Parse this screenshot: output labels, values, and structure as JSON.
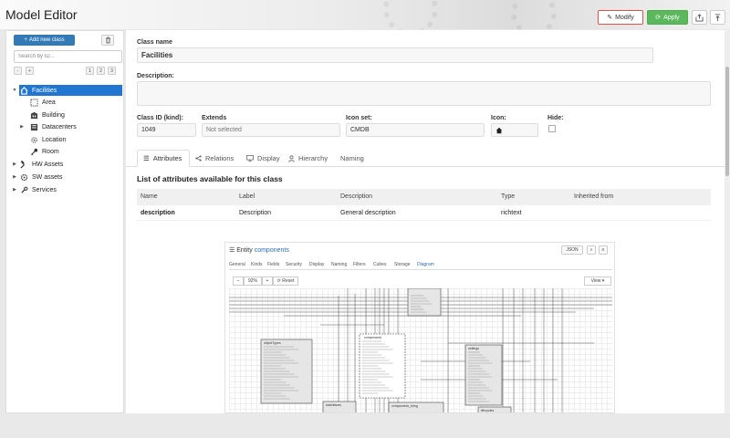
{
  "app": {
    "title": "Model Editor"
  },
  "toolbar": {
    "modify_label": "Modify",
    "apply_label": "Apply"
  },
  "sidebar": {
    "add_label": "Add new class",
    "search_placeholder": "Search by ID...",
    "collapse_label": "-",
    "expand_label": "+",
    "levels": [
      "1",
      "2",
      "3"
    ],
    "tree": [
      {
        "label": "Facilities",
        "icon": "home-icon",
        "selected": true
      },
      {
        "label": "Area",
        "icon": "dashed-square-icon"
      },
      {
        "label": "Building",
        "icon": "building-icon"
      },
      {
        "label": "Datacenters",
        "icon": "datacenter-icon"
      },
      {
        "label": "Location",
        "icon": "crosshair-icon"
      },
      {
        "label": "Room",
        "icon": "key-icon"
      },
      {
        "label": "HW Assets",
        "icon": "hammer-icon"
      },
      {
        "label": "SW assets",
        "icon": "gears-icon"
      },
      {
        "label": "Services",
        "icon": "wrench-icon"
      }
    ]
  },
  "form": {
    "class_name_label": "Class name",
    "class_name_value": "Facilities",
    "description_label": "Description:",
    "description_value": "",
    "class_id_label": "Class ID (kind):",
    "class_id_value": "1049",
    "extends_label": "Extends",
    "extends_value": "Not selected",
    "iconset_label": "Icon set:",
    "iconset_value": "CMDB",
    "icon_label": "Icon:",
    "hide_label": "Hide:"
  },
  "tabs": [
    {
      "label": "Attributes",
      "icon": "list-icon",
      "active": true
    },
    {
      "label": "Relations",
      "icon": "share-icon"
    },
    {
      "label": "Display",
      "icon": "monitor-icon"
    },
    {
      "label": "Hierarchy",
      "icon": "person-icon"
    },
    {
      "label": "Naming",
      "icon": ""
    }
  ],
  "attributes": {
    "heading": "List of attributes available for this class",
    "columns": [
      "Name",
      "Label",
      "Description",
      "Type",
      "Inherited from"
    ],
    "rows": [
      {
        "name": "description",
        "label": "Description",
        "description": "General description",
        "type": "richtext",
        "inherited": ""
      }
    ]
  },
  "diagram": {
    "title_prefix": "Entity",
    "title_entity": "components",
    "json_label": "JSON",
    "tabs": [
      "General",
      "Kinds",
      "Fields",
      "Security",
      "Display",
      "Naming",
      "Filters",
      "Cubes",
      "Storage",
      "Diagram"
    ],
    "active_tab": "Diagram",
    "zoom": "92%",
    "reset_label": "Reset",
    "view_label": "View",
    "zoom_out": "−",
    "zoom_in": "+",
    "entities": [
      "objectTypes",
      "components",
      "settings",
      "batchfaces",
      "components_bring",
      "lifecycles"
    ]
  }
}
